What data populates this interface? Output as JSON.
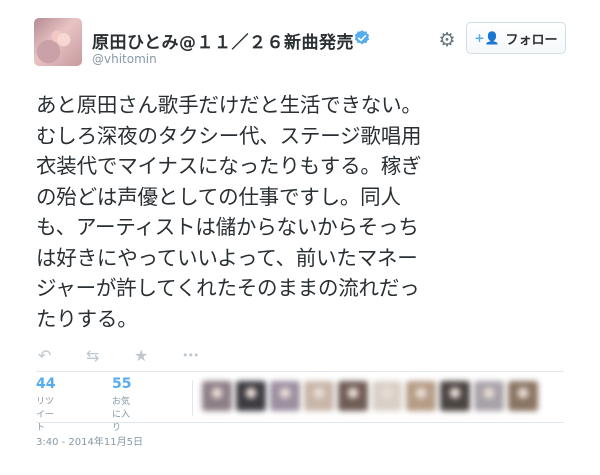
{
  "user": {
    "display_name": "原田ひとみ@１１／２６新曲発売",
    "handle": "@vhitomin"
  },
  "header": {
    "follow_label": "フォロー",
    "follow_icon": "+👤",
    "gear_icon": "gear-icon"
  },
  "tweet": {
    "text": "あと原田さん歌手だけだと生活できない。\nむしろ深夜のタクシー代、ステージ歌唱用\n衣装代でマイナスになったりもする。稼ぎ\nの殆どは声優としての仕事ですし。同人\nも、アーティストは儲からないからそっち\nは好きにやっていいよって、前いたマネー\nジャーが許してくれたそのままの流れだっ\nたりする。"
  },
  "actions": [
    {
      "name": "reply",
      "glyph": "↶"
    },
    {
      "name": "retweet",
      "glyph": "⇆"
    },
    {
      "name": "favorite",
      "glyph": "★"
    },
    {
      "name": "more",
      "glyph": "•••"
    }
  ],
  "stats": {
    "retweets": {
      "count": "44",
      "label": "リツイート"
    },
    "favorites": {
      "count": "55",
      "label": "お気に入り"
    }
  },
  "favoriter_avatar_colors": [
    "#8c7e86",
    "#3d3a40",
    "#9c8fa0",
    "#c8b6a8",
    "#6f5c55",
    "#d9d0c8",
    "#b59c86",
    "#4a4340",
    "#a7a2a8",
    "#8a7462"
  ],
  "timestamp": "3:40 - 2014年11月5日",
  "colors": {
    "accent": "#55acee",
    "text": "#292f33",
    "muted": "#8899a6"
  }
}
